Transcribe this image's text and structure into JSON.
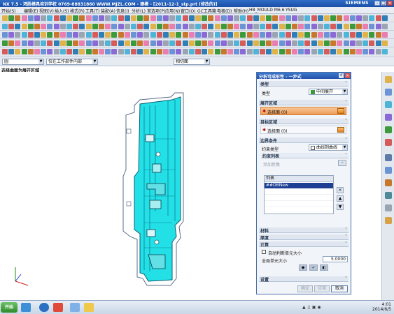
{
  "window": {
    "title": "NX 7.5 - 鸿胜模具培训学校  0769-88831860  WWW.MJZL.COM - 建模 - [2011-12-1_stp.prt (修改的)]",
    "brand": "SIEMENS"
  },
  "menu": {
    "items": [
      "开始(S)",
      "文件(F)",
      "编辑(E)",
      "视图(V)",
      "插入(S)",
      "格式(R)",
      "工具(T)",
      "装配(A)",
      "信息(I)",
      "分析(L)",
      "首选项(P)",
      "应用(N)",
      "窗口(O)",
      "GC工具箱",
      "电极(D)",
      "帮助(H)",
      "HB_MOULD M6.6",
      "YSUG"
    ]
  },
  "filterbar": {
    "type_filter": "圆",
    "scope_filter": "仅在工作部件内部",
    "snap_filter": "相切面"
  },
  "status": {
    "prompt": "选择曲面为展开区域"
  },
  "dialog": {
    "title": "分析可成形性 - 一步式",
    "sections": {
      "type": "类型",
      "unfold_region": "展开区域",
      "target_region": "目标区域",
      "boundary": "边界条件",
      "material": "材料",
      "thickness": "厚度",
      "compute": "计算",
      "settings": "设置"
    },
    "type_label": "类型",
    "type_value": "中间展开",
    "unfold_select": "选择面 (0)",
    "target_select": "选择面 (0)",
    "constraint_type_label": "约束类型",
    "constraint_type_value": "曲线到曲线",
    "constraint_list_label": "约束列表",
    "add_new_label": "添加新集",
    "list_header": "列表",
    "list_rows": [
      "##DBNew"
    ],
    "auto_mesh_label": "自动判断单元大小",
    "global_size_label": "全局单元大小",
    "global_size_value": "5.0000",
    "buttons": {
      "ok": "确定",
      "apply": "应用",
      "cancel": "取消"
    }
  },
  "taskbar": {
    "start": "开始",
    "time": "4:01",
    "date": "2014/6/5"
  },
  "colors": {
    "part": "#22e0e6",
    "part_edge": "#0a5f73",
    "accent": "#2353a8"
  }
}
